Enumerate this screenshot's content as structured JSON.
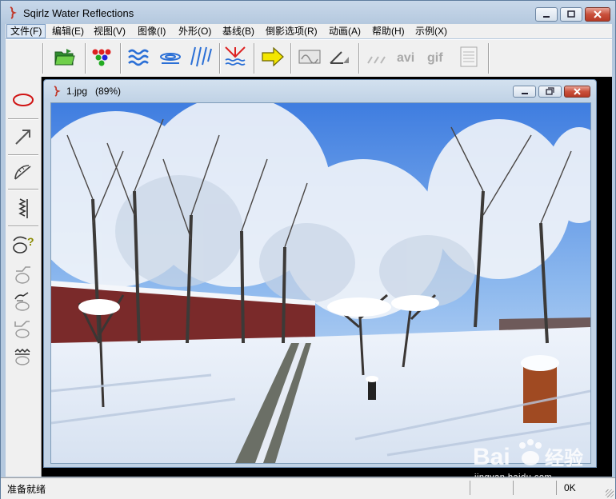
{
  "window": {
    "title": "Sqirlz Water Reflections",
    "minimize_label": "minimize",
    "maximize_label": "maximize",
    "close_label": "close"
  },
  "menu": [
    {
      "label": "文件(F)"
    },
    {
      "label": "编辑(E)"
    },
    {
      "label": "视图(V)"
    },
    {
      "label": "图像(I)"
    },
    {
      "label": "外形(O)"
    },
    {
      "label": "基线(B)"
    },
    {
      "label": "倒影选项(R)"
    },
    {
      "label": "动画(A)"
    },
    {
      "label": "帮助(H)"
    },
    {
      "label": "示例(X)"
    }
  ],
  "toolbar": {
    "items": [
      {
        "icon": "open-folder-icon"
      },
      {
        "icon": "color-dots-icon"
      },
      {
        "icon": "water-waves-icon"
      },
      {
        "icon": "ripple-icon"
      },
      {
        "icon": "rain-icon"
      },
      {
        "icon": "reflection-icon"
      },
      {
        "icon": "arrow-right-icon"
      },
      {
        "icon": "texture-icon"
      },
      {
        "icon": "angle-icon"
      },
      {
        "icon": "lines-disabled-icon"
      },
      {
        "icon": "avi-icon",
        "text": "avi"
      },
      {
        "icon": "gif-icon",
        "text": "gif"
      },
      {
        "icon": "document-icon"
      }
    ]
  },
  "sidebar": {
    "items": [
      {
        "icon": "ellipse-icon"
      },
      {
        "icon": "arrow-diagonal-icon"
      },
      {
        "icon": "protractor-icon"
      },
      {
        "icon": "zigzag-icon"
      },
      {
        "icon": "shape-help-icon",
        "text": "?"
      },
      {
        "icon": "shape-icon-1"
      },
      {
        "icon": "shape-icon-2"
      },
      {
        "icon": "shape-icon-3"
      },
      {
        "icon": "shape-icon-4"
      }
    ]
  },
  "document": {
    "title": "1.jpg   (89%)"
  },
  "status": {
    "text": "准备就绪",
    "right": "0K"
  },
  "watermark": {
    "text": "jingyan.baidu.com"
  },
  "colors": {
    "accent": "#3a6ea5",
    "close": "#c9503b",
    "ellipse": "#d01414",
    "arrow": "#f3e600"
  }
}
